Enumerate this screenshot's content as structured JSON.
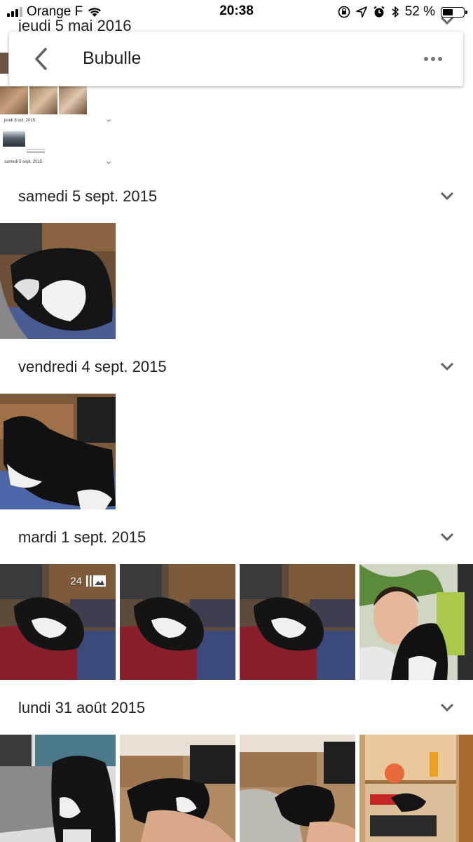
{
  "status_bar": {
    "carrier": "Orange F",
    "time": "20:38",
    "battery": "52 %",
    "battery_level": 0.52
  },
  "top_obscured_date": "jeudi 5 mai 2016",
  "app_bar": {
    "title": "Bubulle"
  },
  "mini_preview": {
    "labels": [
      "jeudi 8 oct. 2015",
      "samedi 5 sept. 2015"
    ]
  },
  "sections": [
    {
      "date": "samedi 5 sept. 2015"
    },
    {
      "date": "vendredi 4 sept. 2015"
    },
    {
      "date": "mardi 1 sept. 2015",
      "burst_count": "24"
    },
    {
      "date": "lundi 31 août 2015"
    }
  ],
  "icons": {
    "back": "back-arrow-icon",
    "more": "more-horizontal-icon",
    "chevron": "chevron-down-icon",
    "burst": "burst-photos-icon"
  }
}
